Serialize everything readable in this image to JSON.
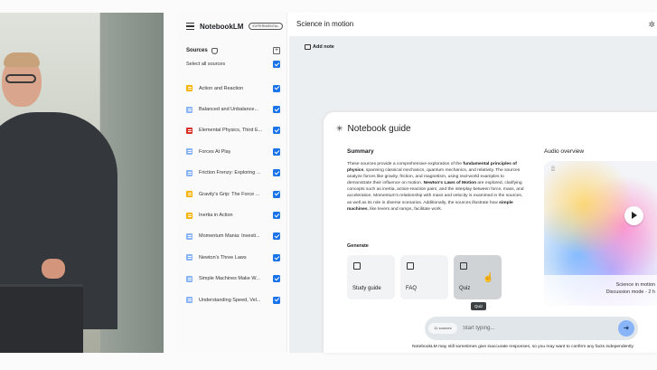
{
  "app": {
    "brand": "NotebookLM",
    "badge": "EXPERIMENTAL",
    "notebook_title": "Science in motion"
  },
  "sources": {
    "title": "Sources",
    "select_all": "Select all sources",
    "items": [
      {
        "label": "Action and Reaction",
        "icon_color": "#f4b400"
      },
      {
        "label": "Balanced and Unbalance...",
        "icon_color": "#8ab4f8"
      },
      {
        "label": "Elemental Physics, Third E...",
        "icon_color": "#d93025"
      },
      {
        "label": "Forces At Play",
        "icon_color": "#8ab4f8"
      },
      {
        "label": "Friction Frenzy: Exploring ...",
        "icon_color": "#8ab4f8"
      },
      {
        "label": "Gravity's Grip: The Force ...",
        "icon_color": "#f4b400"
      },
      {
        "label": "Inertia in Action",
        "icon_color": "#f4b400"
      },
      {
        "label": "Momentum Mania: Investi...",
        "icon_color": "#8ab4f8"
      },
      {
        "label": "Newton's Three Laws",
        "icon_color": "#8ab4f8"
      },
      {
        "label": "Simple Machines Make W...",
        "icon_color": "#8ab4f8"
      },
      {
        "label": "Understanding Speed, Vel...",
        "icon_color": "#8ab4f8"
      }
    ]
  },
  "main": {
    "add_note": "Add note",
    "guide": {
      "title": "Notebook guide",
      "summary_heading": "Summary",
      "summary": [
        {
          "t": "These sources provide a comprehensive exploration of the ",
          "b": false
        },
        {
          "t": "fundamental principles of physics",
          "b": true
        },
        {
          "t": ", spanning classical mechanics, quantum mechanics, and relativity. The sources analyze forces like gravity, friction, and magnetism, using real-world examples to demonstrate their influence on motion. ",
          "b": false
        },
        {
          "t": "Newton's Laws of Motion",
          "b": true
        },
        {
          "t": " are explored, clarifying concepts such as inertia, action-reaction pairs, and the interplay between force, mass, and acceleration. Momentum's relationship with mass and velocity is examined in the sources, as well as its role in diverse scenarios. Additionally, the sources illustrate how ",
          "b": false
        },
        {
          "t": "simple machines",
          "b": true
        },
        {
          "t": ", like levers and ramps, facilitate work.",
          "b": false
        }
      ],
      "generate_heading": "Generate",
      "generate_cards": [
        "Study guide",
        "FAQ",
        "Quiz"
      ],
      "tooltip": "Quiz",
      "audio_heading": "Audio overview",
      "audio_name": "Science in motion",
      "audio_mode": "Discussion mode - 2 h"
    },
    "chat": {
      "chip": "11 sources",
      "placeholder": "Start typing...",
      "send_icon": "arrow-right-icon"
    },
    "disclaimer": "NotebookLM may still sometimes give inaccurate responses, so you may want to confirm any facts independently"
  },
  "colors": {
    "accent": "#1a73e8",
    "send": "#8ab4f8"
  }
}
